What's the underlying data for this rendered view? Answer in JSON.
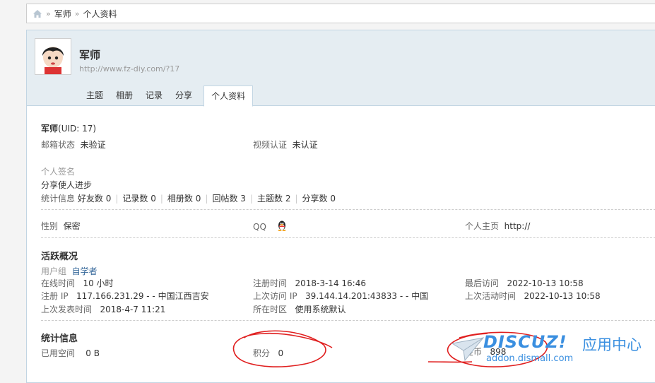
{
  "breadcrumb": {
    "home_icon": "home-icon",
    "separator": "»",
    "items": [
      "军师",
      "个人资料"
    ]
  },
  "profile": {
    "name": "军师",
    "url": "http://www.fz-diy.com/?17",
    "tabs": [
      "主题",
      "相册",
      "记录",
      "分享",
      "个人资料"
    ],
    "active_tab": "个人资料"
  },
  "basic": {
    "name": "军师",
    "uid": "(UID: 17)",
    "email_label": "邮箱状态",
    "email_value": "未验证",
    "video_label": "视频认证",
    "video_value": "未认证",
    "signature_label": "个人签名",
    "signature_value": "分享使人进步",
    "stats_label": "统计信息",
    "stats": [
      {
        "label": "好友数",
        "value": "0"
      },
      {
        "label": "记录数",
        "value": "0"
      },
      {
        "label": "相册数",
        "value": "0"
      },
      {
        "label": "回帖数",
        "value": "3"
      },
      {
        "label": "主题数",
        "value": "2"
      },
      {
        "label": "分享数",
        "value": "0"
      }
    ]
  },
  "contact": {
    "gender_label": "性别",
    "gender_value": "保密",
    "qq_label": "QQ",
    "qq_icon": "qq-penguin-icon",
    "homepage_label": "个人主页",
    "homepage_value": "http://"
  },
  "activity": {
    "title": "活跃概况",
    "group_label": "用户组",
    "group_value": "自学者",
    "online_label": "在线时间",
    "online_value": "10 小时",
    "reg_time_label": "注册时间",
    "reg_time_value": "2018-3-14 16:46",
    "last_visit_label": "最后访问",
    "last_visit_value": "2022-10-13 10:58",
    "reg_ip_label": "注册 IP",
    "reg_ip_value": "117.166.231.29 - - 中国江西吉安",
    "last_ip_label": "上次访问 IP",
    "last_ip_value": "39.144.14.201:43833 - - 中国",
    "last_active_label": "上次活动时间",
    "last_active_value": "2022-10-13 10:58",
    "last_post_label": "上次发表时间",
    "last_post_value": "2018-4-7 11:21",
    "timezone_label": "所在时区",
    "timezone_value": "使用系统默认"
  },
  "statistics": {
    "title": "统计信息",
    "space_label": "已用空间",
    "space_value": "0 B",
    "points_label": "积分",
    "points_value": "0",
    "coins_label": "金币",
    "coins_value": "898"
  },
  "watermark": {
    "logo": "DISCUZ!",
    "cn": "应用中心",
    "url": "addon.dismall.com"
  },
  "colors": {
    "header_bg": "#e5edf2",
    "border": "#c2d5e3",
    "link": "#336699",
    "annotation": "#e02020",
    "watermark": "#3a8fe0"
  }
}
